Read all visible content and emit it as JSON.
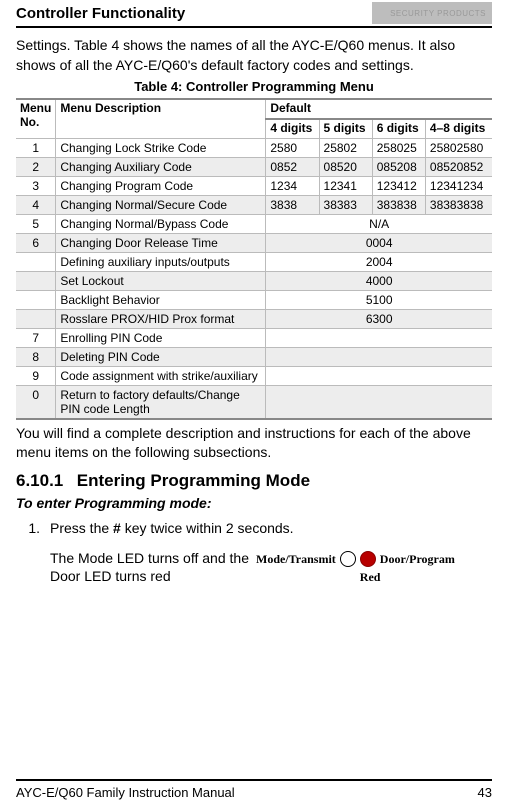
{
  "header": {
    "chapter": "Controller Functionality",
    "logo": "SECURITY PRODUCTS"
  },
  "intro": "Settings. Table 4 shows the names of all the AYC-E/Q60 menus. It also shows of all the AYC-E/Q60's default factory codes and settings.",
  "table": {
    "caption": "Table 4: Controller Programming Menu",
    "head": {
      "menu_no": "Menu No.",
      "desc": "Menu Description",
      "default": "Default",
      "d4": "4 digits",
      "d5": "5 digits",
      "d6": "6 digits",
      "d48": "4–8 digits"
    },
    "rows": [
      {
        "no": "1",
        "desc": "Changing Lock Strike Code",
        "v4": "2580",
        "v5": "25802",
        "v6": "258025",
        "v48": "25802580"
      },
      {
        "no": "2",
        "desc": "Changing Auxiliary Code",
        "v4": "0852",
        "v5": "08520",
        "v6": "085208",
        "v48": "08520852",
        "shade": true
      },
      {
        "no": "3",
        "desc": "Changing Program Code",
        "v4": "1234",
        "v5": "12341",
        "v6": "123412",
        "v48": "12341234"
      },
      {
        "no": "4",
        "desc": "Changing Normal/Secure Code",
        "v4": "3838",
        "v5": "38383",
        "v6": "383838",
        "v48": "38383838",
        "shade": true
      },
      {
        "no": "5",
        "desc": "Changing Normal/Bypass Code",
        "span": "N/A"
      },
      {
        "no": "6",
        "desc": "Changing Door Release Time",
        "span": "0004",
        "shade": true
      },
      {
        "no": "",
        "desc": "Defining auxiliary inputs/outputs",
        "span": "2004"
      },
      {
        "no": "",
        "desc": "Set Lockout",
        "span": "4000",
        "shade": true
      },
      {
        "no": "",
        "desc": "Backlight Behavior",
        "span": "5100"
      },
      {
        "no": "",
        "desc": "Rosslare PROX/HID Prox format",
        "span": "6300",
        "shade": true
      },
      {
        "no": "7",
        "desc": "Enrolling PIN Code",
        "span": ""
      },
      {
        "no": "8",
        "desc": "Deleting PIN Code",
        "span": "",
        "shade": true
      },
      {
        "no": "9",
        "desc": "Code assignment with strike/auxiliary",
        "span": ""
      },
      {
        "no": "0",
        "desc": "Return to factory defaults/Change PIN code Length",
        "span": "",
        "shade": true
      }
    ]
  },
  "followup": "You will find a complete description and instructions for each of the above menu items on the following subsections.",
  "section": {
    "num": "6.10.1",
    "title": "Entering Programming Mode"
  },
  "em_head": "To enter Programming mode:",
  "step": {
    "num": "1.",
    "pre": "Press the ",
    "key": "#",
    "post": " key twice within 2 seconds."
  },
  "mode_text": "The Mode LED turns off and the Door LED turns red",
  "leds": {
    "mode": "Mode/Transmit",
    "door": "Door/Program",
    "red": "Red"
  },
  "footer": {
    "left": "AYC-E/Q60 Family Instruction Manual",
    "right": "43"
  }
}
